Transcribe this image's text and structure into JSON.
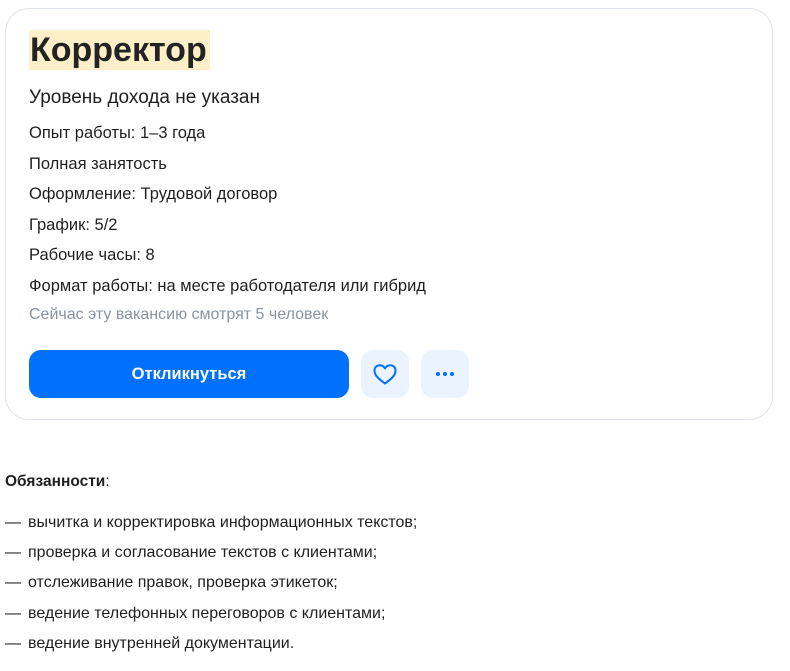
{
  "vacancy": {
    "title": "Корректор",
    "salary": "Уровень дохода не указан",
    "details": [
      "Опыт работы: 1–3 года",
      "Полная занятость",
      "Оформление: Трудовой договор",
      "График: 5/2",
      "Рабочие часы: 8",
      "Формат работы: на месте работодателя или гибрид"
    ],
    "viewers": "Сейчас эту вакансию смотрят 5 человек"
  },
  "actions": {
    "apply_label": "Откликнуться",
    "favorite_icon": "heart-icon",
    "more_icon": "more-dots-icon",
    "accent_color": "#0070ff",
    "icon_button_bg": "#eaf3ff"
  },
  "responsibilities": {
    "heading": "Обязанности",
    "heading_suffix": ":",
    "dash": "—",
    "items": [
      "вычитка и корректировка информационных текстов;",
      "проверка и согласование текстов с клиентами;",
      "отслеживание правок, проверка этикеток;",
      "ведение телефонных переговоров с клиентами;",
      "ведение внутренней документации."
    ]
  }
}
